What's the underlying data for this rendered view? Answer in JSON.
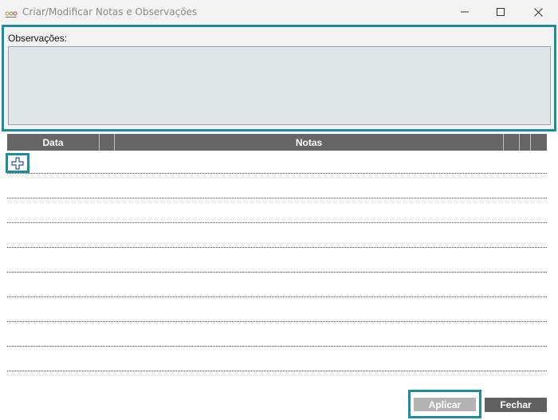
{
  "window": {
    "title": "Criar/Modificar Notas e Observações",
    "app_icon": "notes-app-icon",
    "controls": [
      "minimize-icon",
      "maximize-icon",
      "close-icon"
    ]
  },
  "observations": {
    "label": "Observações:",
    "value": ""
  },
  "grid": {
    "columns": [
      "Data",
      "Notas"
    ],
    "add_icon": "plus-icon",
    "rows": []
  },
  "footer": {
    "apply_label": "Aplicar",
    "close_label": "Fechar"
  },
  "colors": {
    "highlight": "#1a8e9e",
    "header_bg": "#666666",
    "textarea_bg": "#dfe6e8",
    "apply_bg": "#b3b3b3",
    "close_bg": "#606060"
  }
}
